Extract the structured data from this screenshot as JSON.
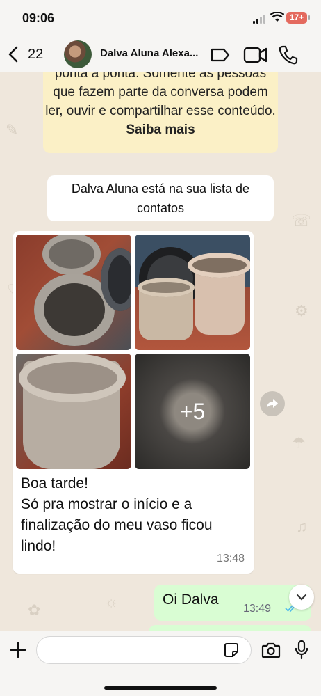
{
  "status_bar": {
    "time": "09:06",
    "battery": "17+"
  },
  "header": {
    "back_count": "22",
    "contact_name": "Dalva Aluna Alexa..."
  },
  "chat": {
    "encryption_notice": "ponta a ponta. Somente as pessoas que fazem parte da conversa podem ler, ouvir e compartilhar esse conteúdo.",
    "learn_more": "Saiba mais",
    "contact_notice": "Dalva Aluna está na sua lista de contatos",
    "incoming": {
      "more_photos": "+5",
      "text": "Boa tarde!\nSó pra mostrar o início e a finalização do meu vaso ficou lindo!",
      "time": "13:48"
    },
    "outgoing": {
      "text": "Oi Dalva",
      "time": "13:49"
    }
  },
  "input": {
    "placeholder": ""
  },
  "colors": {
    "incoming_bg": "#ffffff",
    "outgoing_bg": "#d9fdd3",
    "notice_bg": "#fbf0c6",
    "chat_bg": "#efe7dc",
    "read_ticks": "#53bdeb"
  }
}
